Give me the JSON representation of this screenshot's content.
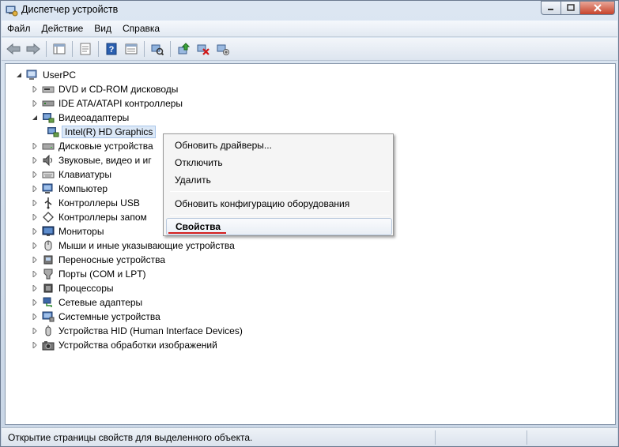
{
  "window": {
    "title": "Диспетчер устройств"
  },
  "menu": [
    "Файл",
    "Действие",
    "Вид",
    "Справка"
  ],
  "toolbar": {
    "buttons": [
      "back-icon",
      "forward-icon",
      "properties-list-icon",
      "computer-props-icon",
      "help-icon",
      "tree-view-icon",
      "scan-hardware-icon",
      "update-driver-icon",
      "uninstall-icon",
      "disable-icon"
    ]
  },
  "tree": {
    "root": "UserPC",
    "items": [
      {
        "label": "DVD и CD-ROM дисководы",
        "icon": "dvd-drive-icon"
      },
      {
        "label": "IDE ATA/ATAPI контроллеры",
        "icon": "ide-controller-icon"
      },
      {
        "label": "Видеоадаптеры",
        "icon": "display-adapter-icon"
      },
      {
        "label": "Intel(R) HD Graphics",
        "icon": "display-adapter-icon"
      },
      {
        "label": "Дисковые устройства",
        "icon": "disk-drive-icon"
      },
      {
        "label": "Звуковые, видео и иг",
        "icon": "sound-icon"
      },
      {
        "label": "Клавиатуры",
        "icon": "keyboard-icon"
      },
      {
        "label": "Компьютер",
        "icon": "computer-icon"
      },
      {
        "label": "Контроллеры USB",
        "icon": "usb-icon"
      },
      {
        "label": "Контроллеры запом",
        "icon": "storage-controller-icon"
      },
      {
        "label": "Мониторы",
        "icon": "monitor-icon"
      },
      {
        "label": "Мыши и иные указывающие устройства",
        "icon": "mouse-icon"
      },
      {
        "label": "Переносные устройства",
        "icon": "portable-device-icon"
      },
      {
        "label": "Порты (COM и LPT)",
        "icon": "port-icon"
      },
      {
        "label": "Процессоры",
        "icon": "processor-icon"
      },
      {
        "label": "Сетевые адаптеры",
        "icon": "network-adapter-icon"
      },
      {
        "label": "Системные устройства",
        "icon": "system-device-icon"
      },
      {
        "label": "Устройства HID (Human Interface Devices)",
        "icon": "hid-icon"
      },
      {
        "label": "Устройства обработки изображений",
        "icon": "imaging-device-icon"
      }
    ]
  },
  "context_menu": {
    "items": [
      "Обновить драйверы...",
      "Отключить",
      "Удалить",
      "Обновить конфигурацию оборудования",
      "Свойства"
    ]
  },
  "status": {
    "text": "Открытие страницы свойств для выделенного объекта."
  },
  "colors": {
    "accent_underline": "#d21e1e",
    "selection": "#dbe8f7"
  }
}
